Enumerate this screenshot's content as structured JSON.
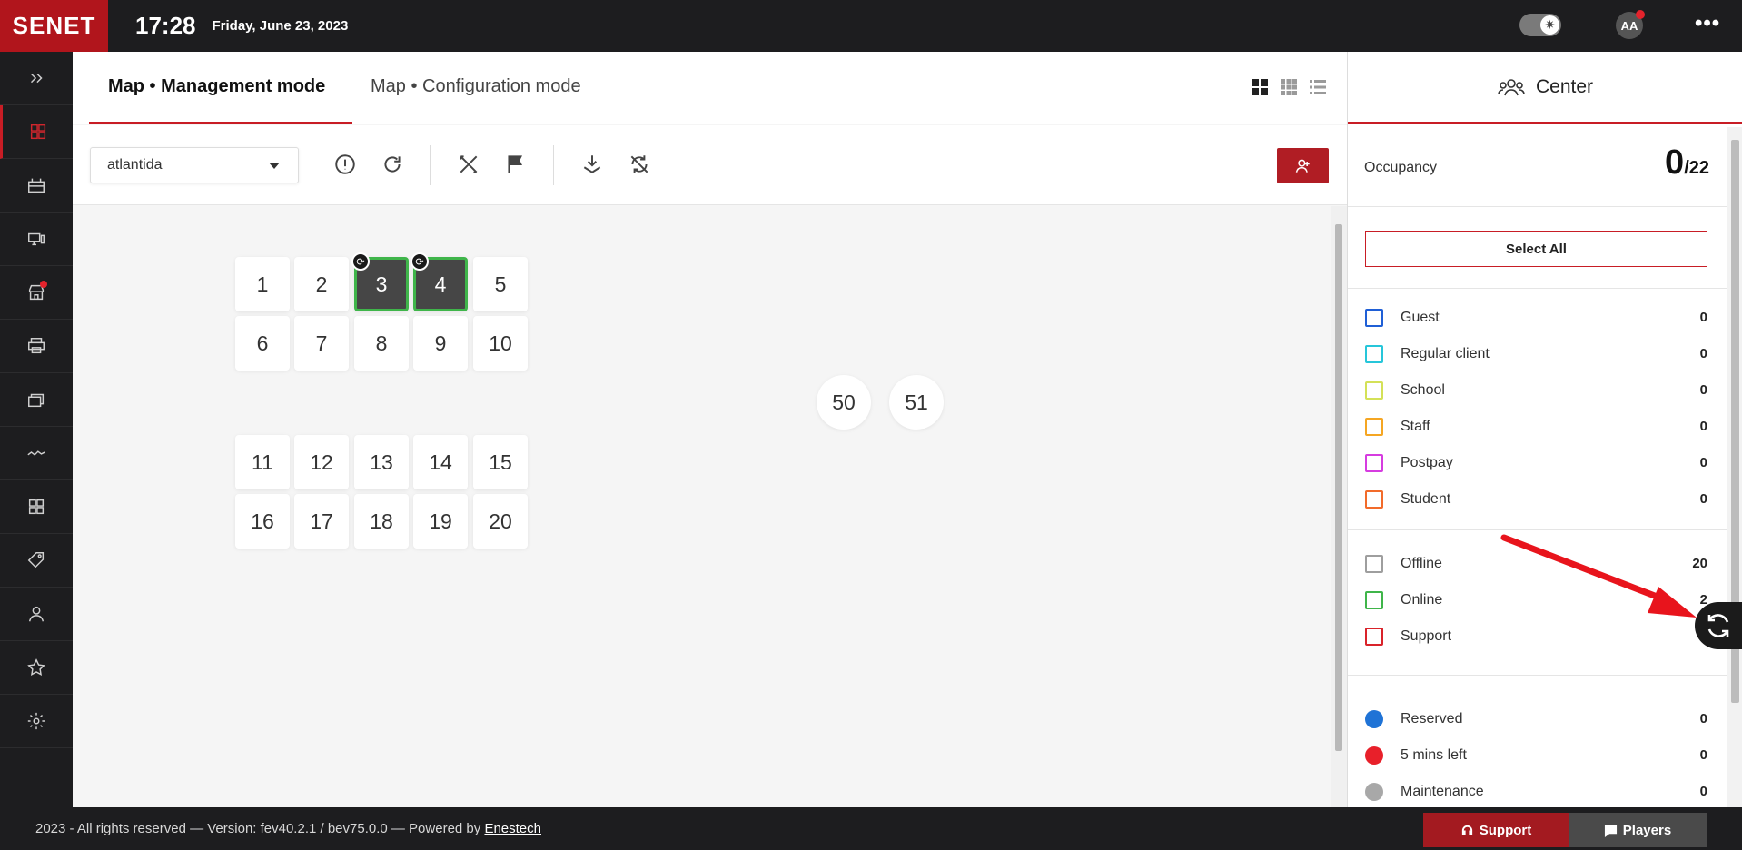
{
  "topbar": {
    "logo": "SENET",
    "time": "17:28",
    "date": "Friday, June 23, 2023",
    "avatar_initials": "AA",
    "more_label": "•••"
  },
  "sidebar": {
    "items": [
      {
        "icon": "chevrons-right-icon"
      },
      {
        "icon": "map-icon",
        "active": true
      },
      {
        "icon": "store-icon"
      },
      {
        "icon": "devices-icon"
      },
      {
        "icon": "shop-icon",
        "badge": true
      },
      {
        "icon": "printer-icon"
      },
      {
        "icon": "cards-icon"
      },
      {
        "icon": "activity-icon"
      },
      {
        "icon": "dashboard-icon"
      },
      {
        "icon": "tags-icon"
      },
      {
        "icon": "users-icon"
      },
      {
        "icon": "star-icon"
      },
      {
        "icon": "gear-icon"
      }
    ]
  },
  "tabs": {
    "management": "Map • Management mode",
    "configuration": "Map • Configuration mode"
  },
  "toolbar": {
    "zone_select_value": "atlantida"
  },
  "map": {
    "stations": [
      {
        "label": "1",
        "status": "offline"
      },
      {
        "label": "2",
        "status": "offline"
      },
      {
        "label": "3",
        "status": "online",
        "sync": true
      },
      {
        "label": "4",
        "status": "online",
        "sync": true
      },
      {
        "label": "5",
        "status": "offline"
      },
      {
        "label": "6",
        "status": "offline"
      },
      {
        "label": "7",
        "status": "offline"
      },
      {
        "label": "8",
        "status": "offline"
      },
      {
        "label": "9",
        "status": "offline"
      },
      {
        "label": "10",
        "status": "offline"
      },
      {
        "label": "11",
        "status": "offline"
      },
      {
        "label": "12",
        "status": "offline"
      },
      {
        "label": "13",
        "status": "offline"
      },
      {
        "label": "14",
        "status": "offline"
      },
      {
        "label": "15",
        "status": "offline"
      },
      {
        "label": "16",
        "status": "offline"
      },
      {
        "label": "17",
        "status": "offline"
      },
      {
        "label": "18",
        "status": "offline"
      },
      {
        "label": "19",
        "status": "offline"
      },
      {
        "label": "20",
        "status": "offline"
      },
      {
        "label": "50",
        "status": "offline",
        "shape": "round"
      },
      {
        "label": "51",
        "status": "offline",
        "shape": "round"
      }
    ]
  },
  "panel": {
    "title": "Center",
    "occupancy_label": "Occupancy",
    "occupancy_current": "0",
    "occupancy_total": "/22",
    "select_all": "Select All",
    "client_types": [
      {
        "label": "Guest",
        "count": "0",
        "color": "#1f5fd6"
      },
      {
        "label": "Regular client",
        "count": "0",
        "color": "#26c6da"
      },
      {
        "label": "School",
        "count": "0",
        "color": "#d4e157"
      },
      {
        "label": "Staff",
        "count": "0",
        "color": "#f5a623"
      },
      {
        "label": "Postpay",
        "count": "0",
        "color": "#d63ce0"
      },
      {
        "label": "Student",
        "count": "0",
        "color": "#f26b2a"
      }
    ],
    "statuses": [
      {
        "label": "Offline",
        "count": "20",
        "color": "#9e9e9e"
      },
      {
        "label": "Online",
        "count": "2",
        "color": "#3fb54a"
      },
      {
        "label": "Support",
        "count": "0",
        "color": "#d9232a"
      }
    ],
    "reservations": [
      {
        "label": "Reserved",
        "count": "0",
        "color": "#1f73d6"
      },
      {
        "label": "5 mins left",
        "count": "0",
        "color": "#e8202a"
      },
      {
        "label": "Maintenance",
        "count": "0",
        "color": "#a8a8a8"
      }
    ]
  },
  "footer": {
    "text": "2023 - All rights reserved — Version: fev40.2.1 / bev75.0.0 — Powered by",
    "link": "Enestech",
    "support_button": "Support",
    "players_button": "Players"
  },
  "colors": {
    "brand_red": "#b1151c",
    "dark": "#1d1d1f",
    "online_green": "#3fb54a"
  }
}
